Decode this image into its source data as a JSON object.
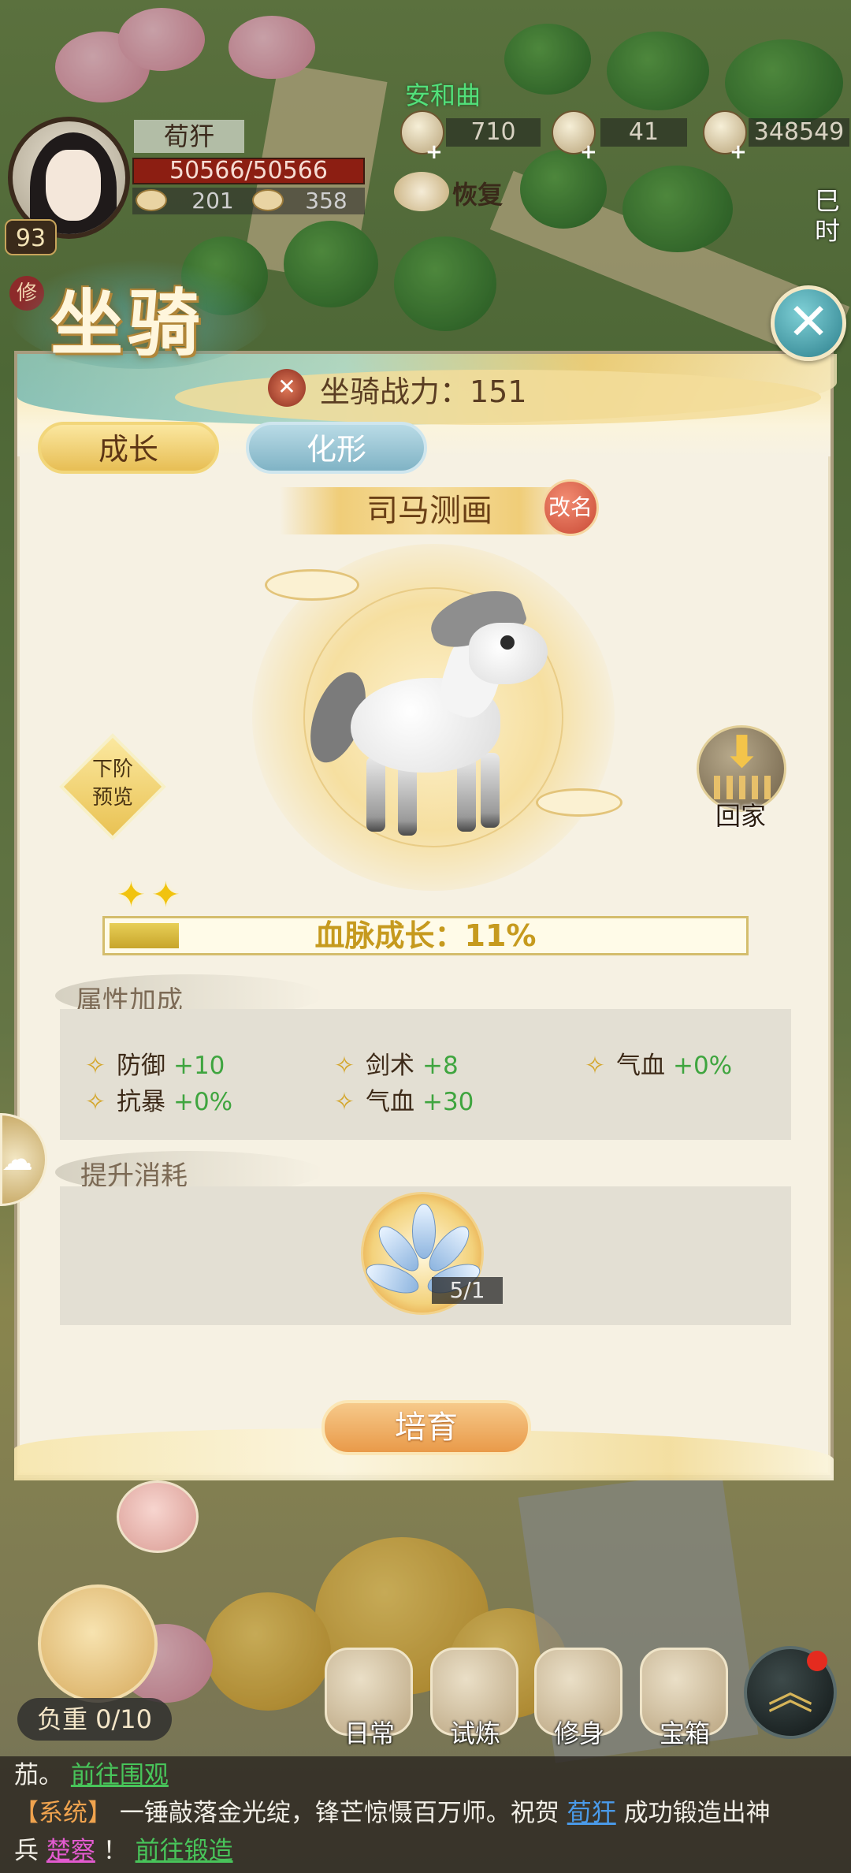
{
  "hud": {
    "location": "安和曲",
    "player": {
      "name": "荀犴",
      "hp": "50566/50566",
      "level": "93",
      "resource_a": "201",
      "resource_b": "358",
      "tag": "修"
    },
    "currencies": [
      {
        "icon": "jade-pendant-icon",
        "value": "710"
      },
      {
        "icon": "silver-ingot-icon",
        "value": "41"
      },
      {
        "icon": "copper-coin-icon",
        "value": "348549"
      }
    ],
    "recover_label": "恢复",
    "time_label": "巳时"
  },
  "modal": {
    "title": "坐骑",
    "power_label": "坐骑战力：151",
    "tabs": [
      {
        "label": "成长",
        "active": true
      },
      {
        "label": "化形",
        "active": false
      }
    ],
    "mount_name": "司马测画",
    "rename_label": "改名",
    "next_stage": {
      "line1": "下阶",
      "line2": "预览"
    },
    "home_label": "回家",
    "stars": 2,
    "growth": {
      "label": "血脉成长：11%",
      "percent": 11
    },
    "attr_section_label": "属性加成",
    "attributes": [
      {
        "name": "防御",
        "value": "+10"
      },
      {
        "name": "剑术",
        "value": "+8"
      },
      {
        "name": "气血",
        "value": "+0%"
      },
      {
        "name": "抗暴",
        "value": "+0%"
      },
      {
        "name": "气血",
        "value": "+30"
      }
    ],
    "cost_section_label": "提升消耗",
    "cost_item": {
      "icon": "blue-orchid-icon",
      "count": "5/1"
    },
    "action_label": "培育"
  },
  "bottom": {
    "load_label": "负重 0/10",
    "nav": [
      {
        "label": "日常",
        "icon": "daily-scroll-icon"
      },
      {
        "label": "试炼",
        "icon": "trial-sword-icon"
      },
      {
        "label": "修身",
        "icon": "cultivation-book-icon"
      },
      {
        "label": "宝箱",
        "icon": "treasure-chest-icon"
      }
    ]
  },
  "chat": {
    "line1_prefix": "茄。",
    "line1_link": "前往围观",
    "line2_tag": "【系统】",
    "line2_text": "一锤敲落金光绽，锋芒惊慑百万师。祝贺",
    "line2_name": "荀犴",
    "line2_suffix": "成功锻造出神",
    "line3_prefix": "兵",
    "line3_item": "楚察",
    "line3_mark": "！",
    "line3_link": "前往锻造"
  },
  "colors": {
    "accent_gold": "#e7be54",
    "attr_value_green": "#3fa53f",
    "chat_link_green": "#48c45a",
    "location_green": "#52e07a"
  }
}
